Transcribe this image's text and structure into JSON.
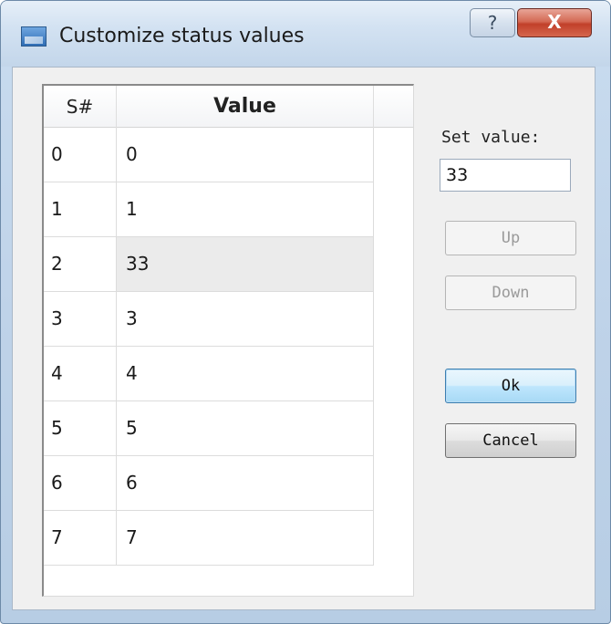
{
  "window": {
    "title": "Customize status values",
    "help_glyph": "?",
    "close_glyph": "X"
  },
  "table": {
    "columns": [
      "S#",
      "Value"
    ],
    "rows": [
      {
        "sn": "0",
        "value": "0"
      },
      {
        "sn": "1",
        "value": "1"
      },
      {
        "sn": "2",
        "value": "33"
      },
      {
        "sn": "3",
        "value": "3"
      },
      {
        "sn": "4",
        "value": "4"
      },
      {
        "sn": "5",
        "value": "5"
      },
      {
        "sn": "6",
        "value": "6"
      },
      {
        "sn": "7",
        "value": "7"
      }
    ],
    "selected_row": 2
  },
  "editor": {
    "label": "Set value:",
    "value": "33"
  },
  "buttons": {
    "up": "Up",
    "down": "Down",
    "ok": "Ok",
    "cancel": "Cancel"
  },
  "colors": {
    "selection": "#ebebeb",
    "close_button": "#c1402a",
    "default_button": "#3c7fb1"
  }
}
